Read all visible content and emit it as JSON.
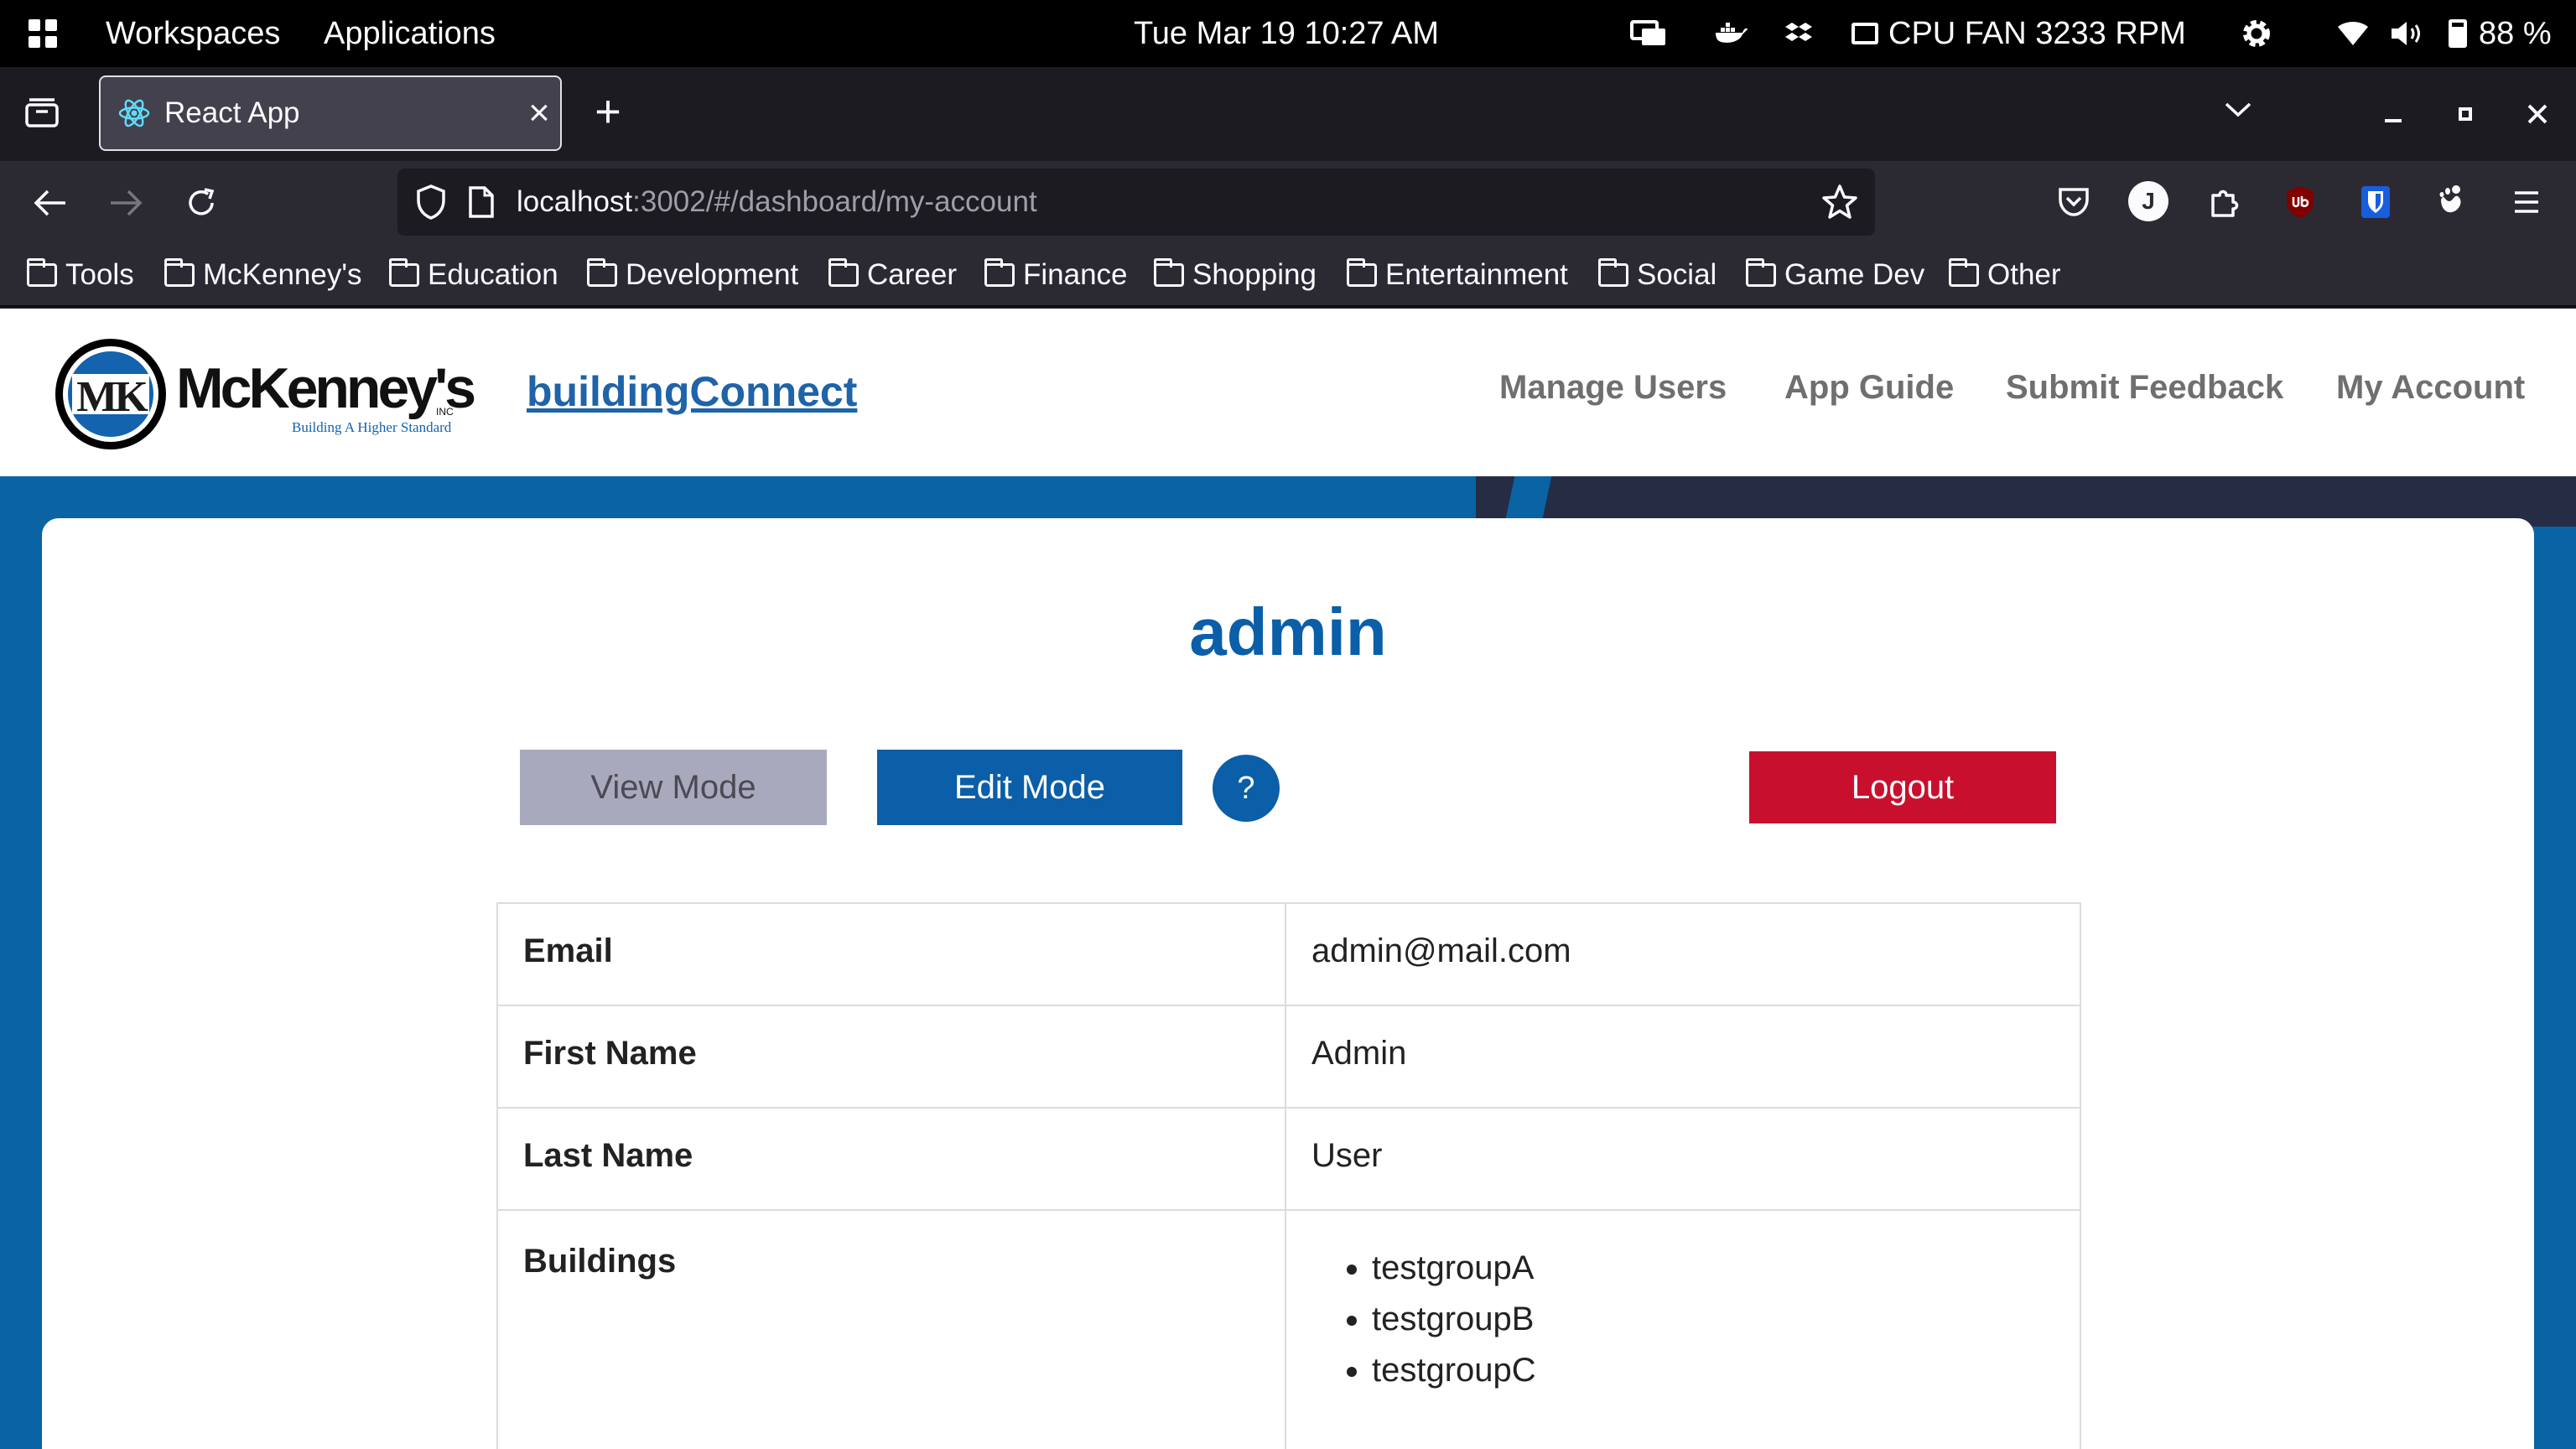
{
  "system_bar": {
    "workspaces": "Workspaces",
    "applications": "Applications",
    "clock": "Tue Mar 19  10:27 AM",
    "fan": "CPU FAN 3233 RPM",
    "battery": "88 %"
  },
  "browser": {
    "tab_title": "React App",
    "url_host": "localhost",
    "url_rest": ":3002/#/dashboard/my-account",
    "extension_badge": "J",
    "bookmarks": [
      "Tools",
      "McKenney's",
      "Education",
      "Development",
      "Career",
      "Finance",
      "Shopping",
      "Entertainment",
      "Social",
      "Game Dev",
      "Other"
    ]
  },
  "site": {
    "logo_text": "McKenney's",
    "logo_tagline": "Building A Higher Standard",
    "logo_inc": "INC",
    "logo_initials": "MK",
    "brand": "buildingConnect",
    "nav": [
      "Manage Users",
      "App Guide",
      "Submit Feedback",
      "My Account"
    ]
  },
  "account": {
    "title": "admin",
    "view_mode": "View Mode",
    "edit_mode": "Edit Mode",
    "help": "?",
    "logout": "Logout",
    "rows": [
      {
        "label": "Email",
        "value": "admin@mail.com"
      },
      {
        "label": "First Name",
        "value": "Admin"
      },
      {
        "label": "Last Name",
        "value": "User"
      },
      {
        "label": "Buildings",
        "values": [
          "testgroupA",
          "testgroupB",
          "testgroupC"
        ]
      }
    ]
  },
  "colors": {
    "accent_blue": "#0b5ea8",
    "logout_red": "#c8102e",
    "hero_blue": "#0a63a3",
    "hero_dark": "#262c44"
  }
}
